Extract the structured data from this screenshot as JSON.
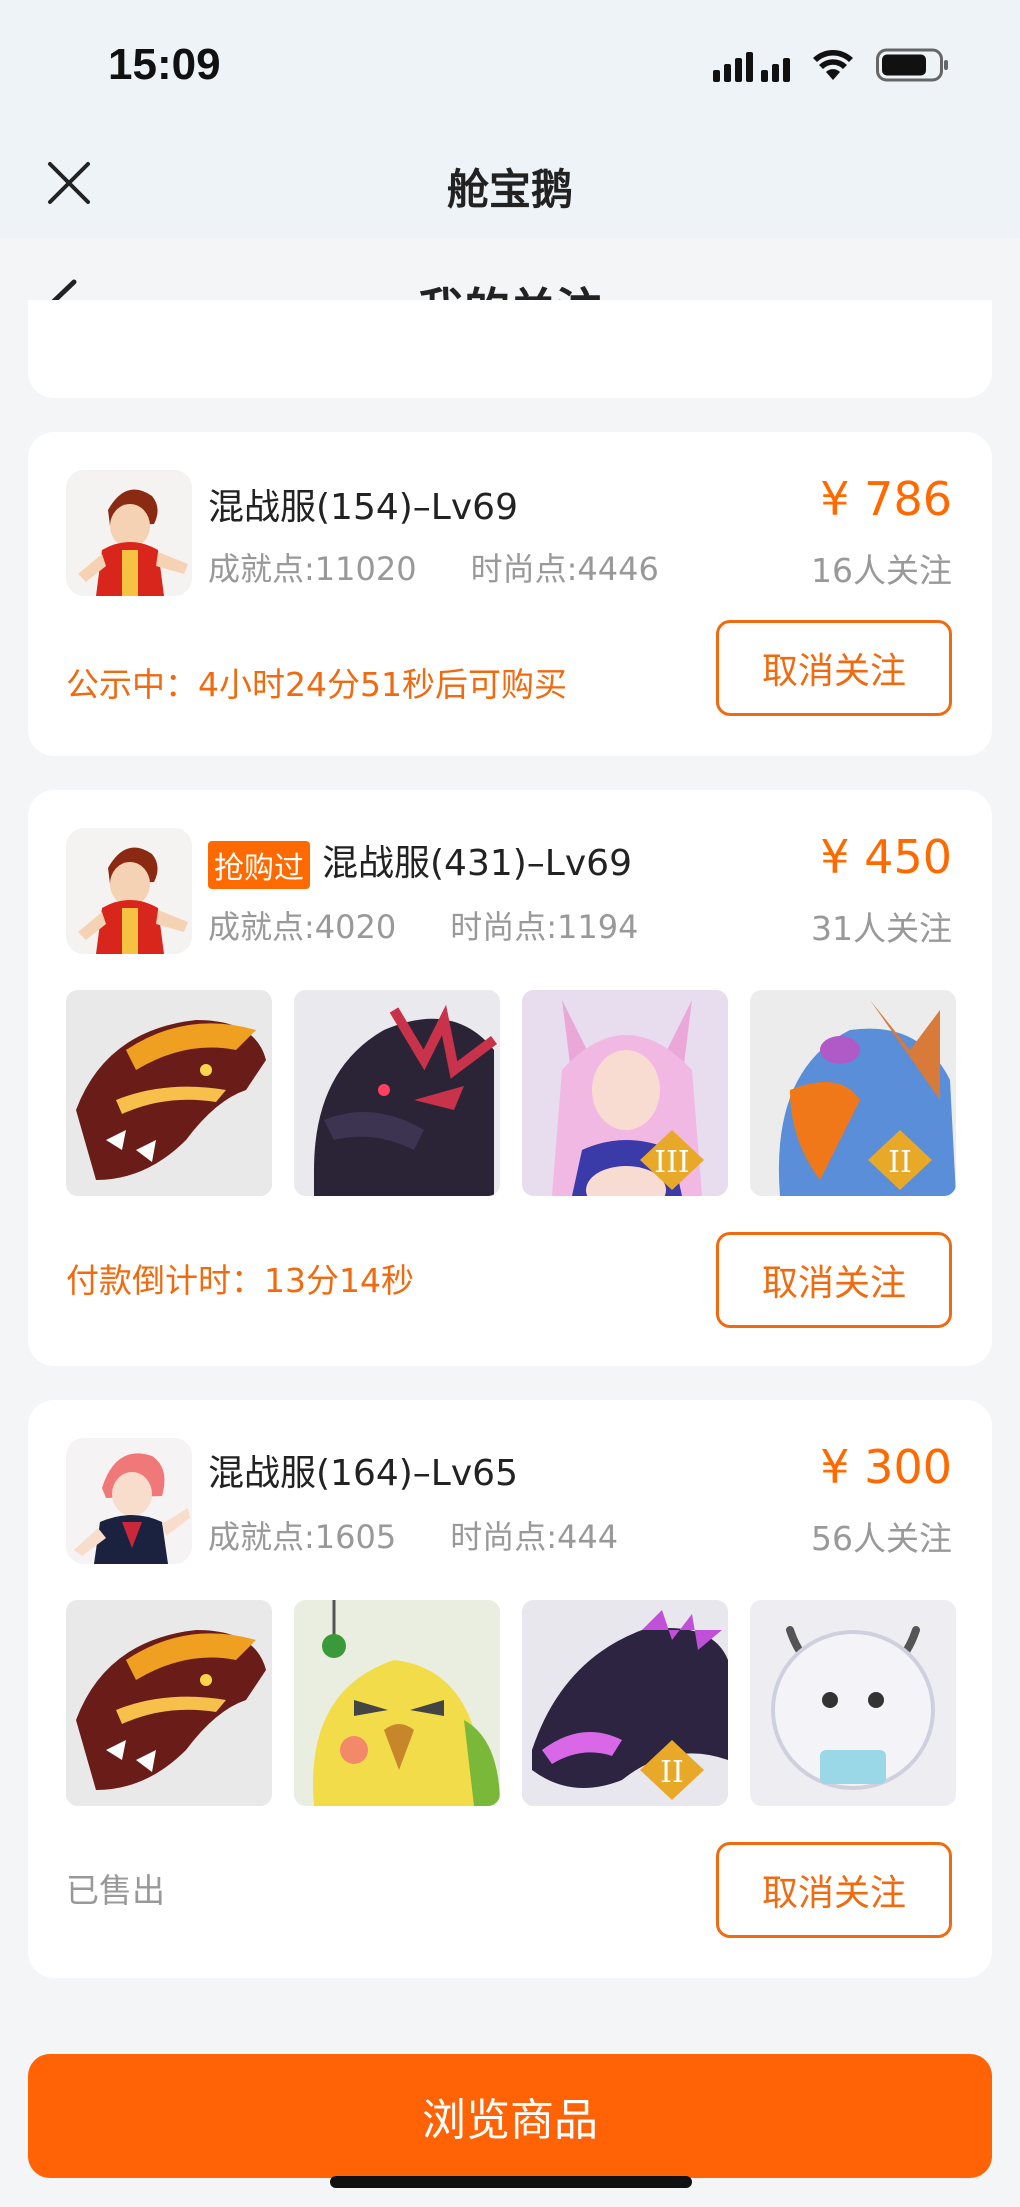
{
  "status_bar": {
    "time": "15:09"
  },
  "app": {
    "title": "舱宝鹅"
  },
  "page": {
    "title": "我的关注"
  },
  "cards": [
    {
      "title": "混战服(154)–Lv69",
      "tag": "",
      "achievement": "成就点:11020",
      "fashion": "时尚点:4446",
      "price": "¥ 786",
      "follows": "16人关注",
      "status": "公示中：4小时24分51秒后可购买",
      "button": "取消关注"
    },
    {
      "title": "混战服(431)–Lv69",
      "tag": "抢购过",
      "achievement": "成就点:4020",
      "fashion": "时尚点:1194",
      "price": "¥ 450",
      "follows": "31人关注",
      "status": "付款倒计时：13分14秒",
      "button": "取消关注",
      "thumbs": [
        "dragon-orange",
        "dragon-black",
        "fox-girl",
        "eagle"
      ]
    },
    {
      "title": "混战服(164)–Lv65",
      "tag": "",
      "achievement": "成就点:1605",
      "fashion": "时尚点:444",
      "price": "¥ 300",
      "follows": "56人关注",
      "status": "已售出",
      "button": "取消关注",
      "thumbs": [
        "dragon-orange",
        "yellow-bird",
        "purple-beast",
        "white-cow"
      ]
    }
  ],
  "bottom_button": "浏览商品",
  "colors": {
    "accent": "#ff6a00",
    "bg": "#f4f5f7",
    "header": "#edf3f7"
  }
}
